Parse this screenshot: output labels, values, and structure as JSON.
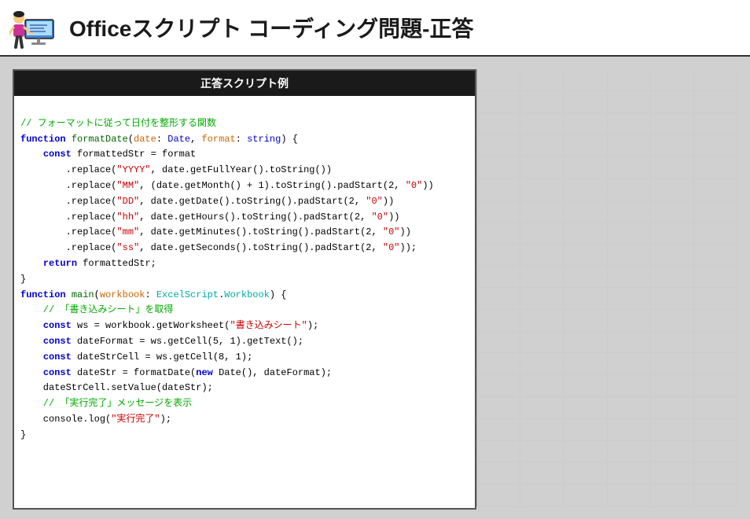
{
  "header": {
    "title": "Officeスクリプト コーディング問題-正答"
  },
  "panel": {
    "title": "正答スクリプト例"
  },
  "code": {
    "comment1": "// フォーマットに従って日付を整形する関数",
    "func1_sig": "function formatDate(date: Date, format: string) {",
    "line1": "    const formattedStr = format",
    "line2": "        .replace(\"YYYY\", date.getFullYear().toString())",
    "line3": "        .replace(\"MM\", (date.getMonth() + 1).toString().padStart(2, \"0\"))",
    "line4": "        .replace(\"DD\", date.getDate().toString().padStart(2, \"0\"))",
    "line5": "        .replace(\"hh\", date.getHours().toString().padStart(2, \"0\"))",
    "line6": "        .replace(\"mm\", date.getMinutes().toString().padStart(2, \"0\"))",
    "line7": "        .replace(\"ss\", date.getSeconds().toString().padStart(2, \"0\"));",
    "line8": "    return formattedStr;",
    "close1": "}",
    "func2_sig": "function main(workbook: ExcelScript.Workbook) {",
    "comment2": "    // 「書き込みシート」を取得",
    "line9": "    const ws = workbook.getWorksheet(\"書き込みシート\");",
    "line10": "    const dateFormat = ws.getCell(5, 1).getText();",
    "line11": "    const dateStrCell = ws.getCell(8, 1);",
    "line12": "    const dateStr = formatDate(new Date(), dateFormat);",
    "line13": "    dateStrCell.setValue(dateStr);",
    "comment3": "    // 「実行完了」メッセージを表示",
    "line14": "    console.log(\"実行完了\");",
    "close2": "}"
  }
}
